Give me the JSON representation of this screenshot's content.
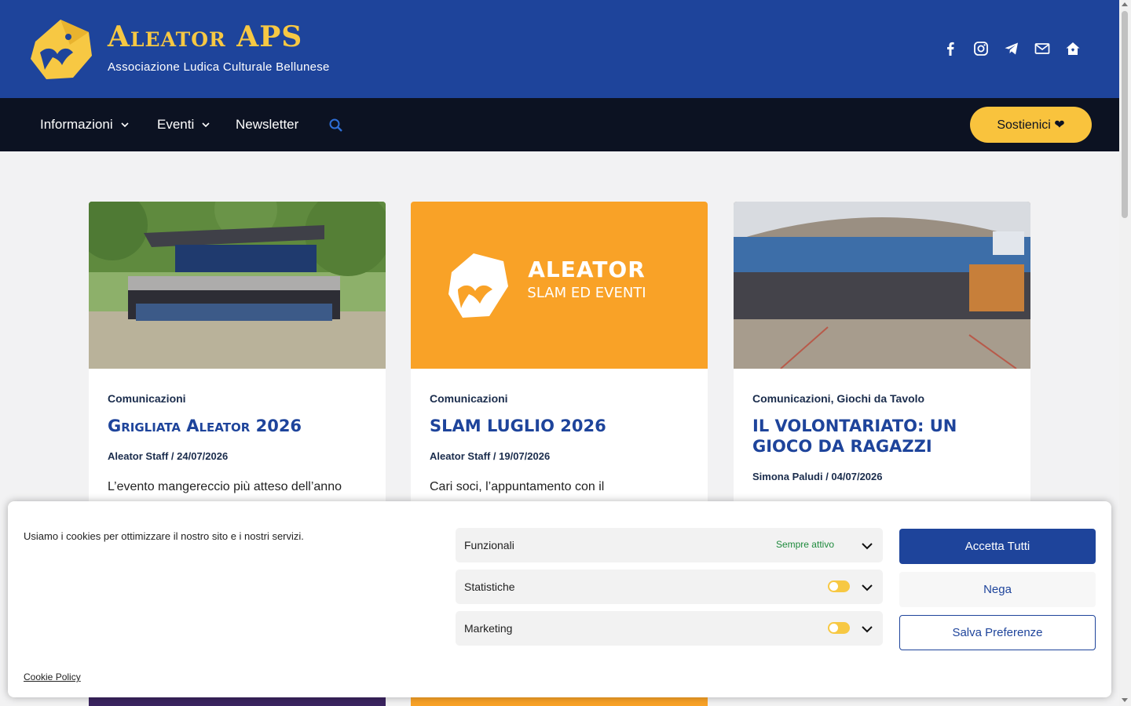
{
  "header": {
    "title": "Aleator APS",
    "subtitle": "Associazione Ludica Culturale Bellunese",
    "socials": [
      "facebook-icon",
      "instagram-icon",
      "telegram-icon",
      "mail-icon",
      "home-icon"
    ]
  },
  "nav": {
    "items": [
      {
        "label": "Informazioni",
        "has_dropdown": true
      },
      {
        "label": "Eventi",
        "has_dropdown": true
      },
      {
        "label": "Newsletter",
        "has_dropdown": false
      }
    ],
    "donate_label": "Sostienici ❤"
  },
  "cards": [
    {
      "categories": [
        "Comunicazioni"
      ],
      "title": "Grigliata Aleator 2026",
      "author": "Aleator Staff",
      "date": "24/07/2026",
      "excerpt": "L’evento mangereccio più atteso dell’anno"
    },
    {
      "categories": [
        "Comunicazioni"
      ],
      "title": "SLAM LUGLIO 2026",
      "author": "Aleator Staff",
      "date": "19/07/2026",
      "excerpt": "Cari soci, l’appuntamento con il",
      "image_text": {
        "line1": "ALEATOR",
        "line2": "SLAM ED EVENTI"
      }
    },
    {
      "categories": [
        "Comunicazioni",
        "Giochi da Tavolo"
      ],
      "title": "IL VOLONTARIATO: UN GIOCO DA RAGAZZI",
      "author": "Simona Paludi",
      "date": "04/07/2026",
      "excerpt": ""
    }
  ],
  "cookie": {
    "message": "Usiamo i cookies per ottimizzare il nostro sito e i nostri servizi.",
    "policy_link": "Cookie Policy",
    "categories": [
      {
        "label": "Funzionali",
        "status": "Sempre attivo"
      },
      {
        "label": "Statistiche",
        "status": ""
      },
      {
        "label": "Marketing",
        "status": ""
      }
    ],
    "accept_label": "Accetta Tutti",
    "deny_label": "Nega",
    "save_label": "Salva Preferenze"
  },
  "colors": {
    "brand_blue": "#1e449b",
    "brand_yellow": "#f7c843",
    "nav_dark": "#0c1222",
    "orange_card": "#f9a227"
  }
}
